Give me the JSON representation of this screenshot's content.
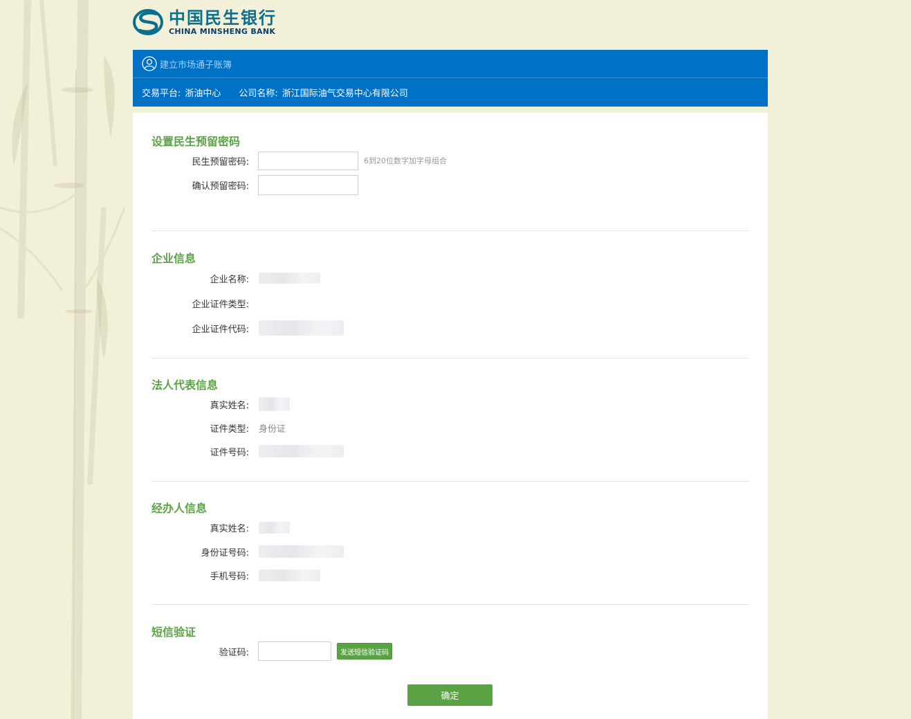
{
  "brand": {
    "name_cn": "中国民生银行",
    "name_en": "CHINA MINSHENG BANK",
    "logo_icon": "minsheng-logo-icon"
  },
  "header": {
    "title": "建立市场通子账簿",
    "platform_label": "交易平台:",
    "platform_value": "浙油中心",
    "company_label": "公司名称:",
    "company_value": "浙江国际油气交易中心有限公司"
  },
  "password_section": {
    "title": "设置民生预留密码",
    "password_label": "民生预留密码:",
    "password_value": "",
    "password_hint": "6到20位数字加字母组合",
    "confirm_label": "确认预留密码:",
    "confirm_value": ""
  },
  "company_section": {
    "title": "企业信息",
    "name_label": "企业名称:",
    "cert_type_label": "企业证件类型:",
    "cert_type_value": "",
    "cert_code_label": "企业证件代码:"
  },
  "legal_section": {
    "title": "法人代表信息",
    "name_label": "真实姓名:",
    "cert_type_label": "证件类型:",
    "cert_type_value": "身份证",
    "cert_no_label": "证件号码:"
  },
  "agent_section": {
    "title": "经办人信息",
    "name_label": "真实姓名:",
    "id_label": "身份证号码:",
    "phone_label": "手机号码:"
  },
  "sms_section": {
    "title": "短信验证",
    "code_label": "验证码:",
    "code_value": "",
    "send_button": "发送短信验证码"
  },
  "confirm_button": "确定",
  "colors": {
    "background": "#f2f0d9",
    "header_blue": "#0072c6",
    "accent_green": "#5aa344"
  }
}
